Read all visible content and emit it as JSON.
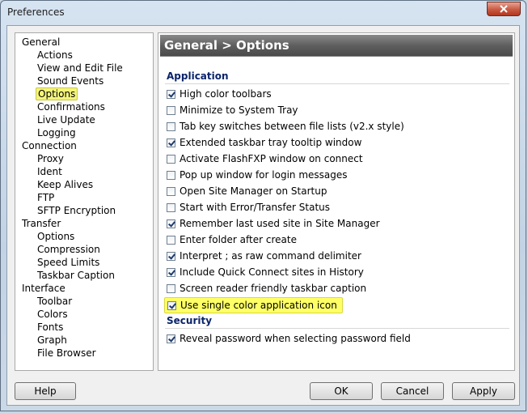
{
  "window": {
    "title": "Preferences"
  },
  "tree": [
    {
      "label": "General",
      "level": 0
    },
    {
      "label": "Actions",
      "level": 1
    },
    {
      "label": "View and Edit File",
      "level": 1
    },
    {
      "label": "Sound Events",
      "level": 1
    },
    {
      "label": "Options",
      "level": 1,
      "selected": true
    },
    {
      "label": "Confirmations",
      "level": 1
    },
    {
      "label": "Live Update",
      "level": 1
    },
    {
      "label": "Logging",
      "level": 1
    },
    {
      "label": "Connection",
      "level": 0
    },
    {
      "label": "Proxy",
      "level": 1
    },
    {
      "label": "Ident",
      "level": 1
    },
    {
      "label": "Keep Alives",
      "level": 1
    },
    {
      "label": "FTP",
      "level": 1
    },
    {
      "label": "SFTP Encryption",
      "level": 1
    },
    {
      "label": "Transfer",
      "level": 0
    },
    {
      "label": "Options",
      "level": 1
    },
    {
      "label": "Compression",
      "level": 1
    },
    {
      "label": "Speed Limits",
      "level": 1
    },
    {
      "label": "Taskbar Caption",
      "level": 1
    },
    {
      "label": "Interface",
      "level": 0
    },
    {
      "label": "Toolbar",
      "level": 1
    },
    {
      "label": "Colors",
      "level": 1
    },
    {
      "label": "Fonts",
      "level": 1
    },
    {
      "label": "Graph",
      "level": 1
    },
    {
      "label": "File Browser",
      "level": 1
    }
  ],
  "panel": {
    "header": "General > Options",
    "sections": [
      {
        "title": "Application",
        "options": [
          {
            "label": "High color toolbars",
            "checked": true
          },
          {
            "label": "Minimize to System Tray",
            "checked": false
          },
          {
            "label": "Tab key switches between file lists (v2.x style)",
            "checked": false
          },
          {
            "label": "Extended taskbar tray tooltip window",
            "checked": true
          },
          {
            "label": "Activate FlashFXP window on connect",
            "checked": false
          },
          {
            "label": "Pop up window for login messages",
            "checked": false
          },
          {
            "label": "Open Site Manager on Startup",
            "checked": false
          },
          {
            "label": "Start with Error/Transfer Status",
            "checked": false
          },
          {
            "label": "Remember last used site in Site Manager",
            "checked": true
          },
          {
            "label": "Enter folder after create",
            "checked": false
          },
          {
            "label": "Interpret ; as raw command delimiter",
            "checked": true
          },
          {
            "label": "Include Quick Connect sites in History",
            "checked": true
          },
          {
            "label": "Screen reader friendly taskbar caption",
            "checked": false
          },
          {
            "label": "Use single color application icon",
            "checked": true,
            "highlighted": true
          }
        ]
      },
      {
        "title": "Security",
        "options": [
          {
            "label": "Reveal password when selecting password field",
            "checked": true
          }
        ]
      }
    ]
  },
  "buttons": {
    "help": "Help",
    "ok": "OK",
    "cancel": "Cancel",
    "apply": "Apply"
  },
  "colors": {
    "highlight": "#ffff66",
    "section_title": "#0a246a",
    "header_bg": "#5f5f5f"
  }
}
